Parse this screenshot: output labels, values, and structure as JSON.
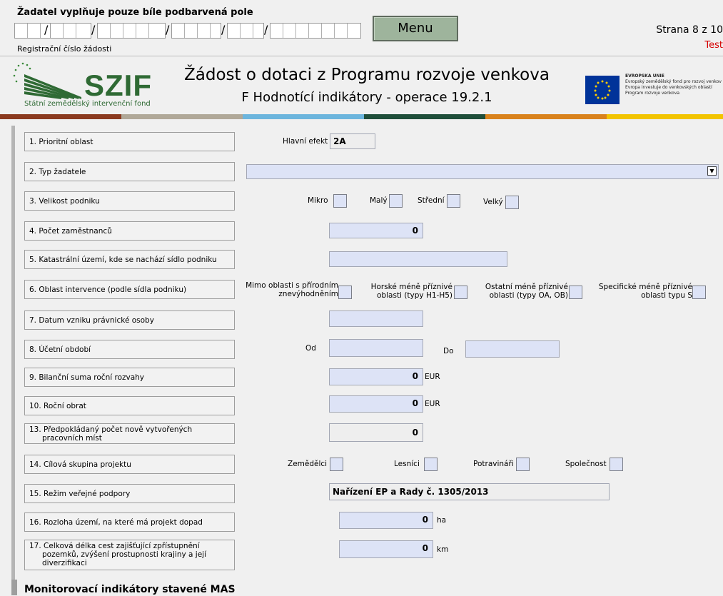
{
  "header": {
    "note": "Žadatel vyplňuje pouze bíle podbarvená pole",
    "reg_label": "Registrační číslo žádosti",
    "slash": "/",
    "menu_label": "Menu",
    "page_info": "Strana 8 z 10",
    "test_label": "Test"
  },
  "logo": {
    "name": "SZIF",
    "subtitle": "Státní zemědělský intervenční fond"
  },
  "title": {
    "line1": "Žádost o dotaci z Programu rozvoje venkova",
    "line2": "F Hodnotící indikátory - operace 19.2.1"
  },
  "eu": {
    "line1": "EVROPSKÁ UNIE",
    "line2": "Evropský zemědělský fond pro rozvoj venkova",
    "line3": "Evropa investuje do venkovských oblastí",
    "line4": "Program rozvoje venkova"
  },
  "stripe_colors": [
    "#8b3a1f",
    "#b0a898",
    "#6cb5dd",
    "#1f4e3a",
    "#d9821c",
    "#f2c400"
  ],
  "rows": {
    "r1": {
      "label": "1. Prioritní oblast",
      "sub_label": "Hlavní efekt",
      "value": "2A"
    },
    "r2": {
      "label": "2. Typ žadatele",
      "value": ""
    },
    "r3": {
      "label": "3. Velikost podniku",
      "opt1": "Mikro",
      "opt2": "Malý",
      "opt3": "Střední",
      "opt4": "Velký"
    },
    "r4": {
      "label": "4. Počet zaměstnanců",
      "value": "0"
    },
    "r5": {
      "label": "5. Katastrální území, kde se nachází sídlo podniku",
      "value": ""
    },
    "r6": {
      "label": "6. Oblast intervence (podle sídla podniku)",
      "opt1a": "Mimo oblasti s přírodním",
      "opt1b": "znevýhodněním",
      "opt2a": "Horské méně příznivé",
      "opt2b": "oblasti (typy H1-H5)",
      "opt3a": "Ostatní méně příznivé",
      "opt3b": "oblasti (typy OA, OB)",
      "opt4a": "Specifické méně příznivé",
      "opt4b": "oblasti typu S"
    },
    "r7": {
      "label": "7. Datum vzniku právnické osoby",
      "value": ""
    },
    "r8": {
      "label": "8. Účetní období",
      "from_label": "Od",
      "to_label": "Do"
    },
    "r9": {
      "label": "9. Bilanční suma roční rozvahy",
      "value": "0",
      "unit": "EUR"
    },
    "r10": {
      "label": "10. Roční obrat",
      "value": "0",
      "unit": "EUR"
    },
    "r13": {
      "label_a": "13. Předpokládaný počet nově vytvořených",
      "label_b": "pracovních míst",
      "value": "0"
    },
    "r14": {
      "label": "14. Cílová skupina projektu",
      "opt1": "Zemědělci",
      "opt2": "Lesníci",
      "opt3": "Potravináři",
      "opt4": "Společnost"
    },
    "r15": {
      "label": "15. Režim veřejné podpory",
      "value": "Nařízení EP a Rady č. 1305/2013"
    },
    "r16": {
      "label": "16. Rozloha území, na které má projekt dopad",
      "value": "0",
      "unit": "ha"
    },
    "r17": {
      "label_a": "17. Celková délka cest zajišťující zpřístupnění",
      "label_b": "pozemků, zvýšení prostupnosti krajiny a její",
      "label_c": "diverzifikaci",
      "value": "0",
      "unit": "km"
    }
  },
  "section_bottom": "Monitorovací indikátory stavené MAS"
}
